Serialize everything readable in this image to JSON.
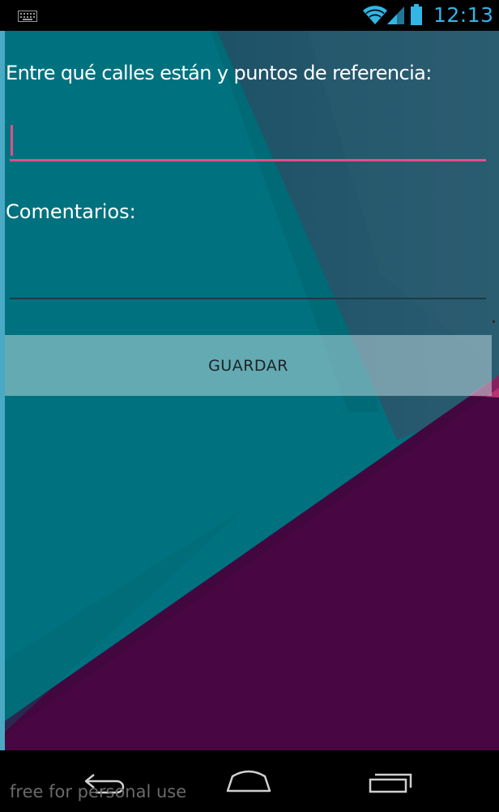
{
  "status_bar": {
    "time": "12:13",
    "icons": [
      "keyboard-icon",
      "wifi-icon",
      "signal-icon",
      "battery-icon"
    ],
    "accent_color": "#33b5e5"
  },
  "form": {
    "streets_label": "Entre qué calles están y puntos de referencia:",
    "streets_value": "",
    "comments_label": "Comentarios:",
    "comments_value": "",
    "save_label": "GUARDAR"
  },
  "colors": {
    "background_teal": "#00727f",
    "background_slate": "#275a70",
    "background_purple": "#480743",
    "focus_underline": "#e0508a"
  },
  "nav_bar": {
    "buttons": [
      "back-icon",
      "home-icon",
      "recents-icon"
    ],
    "watermark": "free for personal use"
  }
}
